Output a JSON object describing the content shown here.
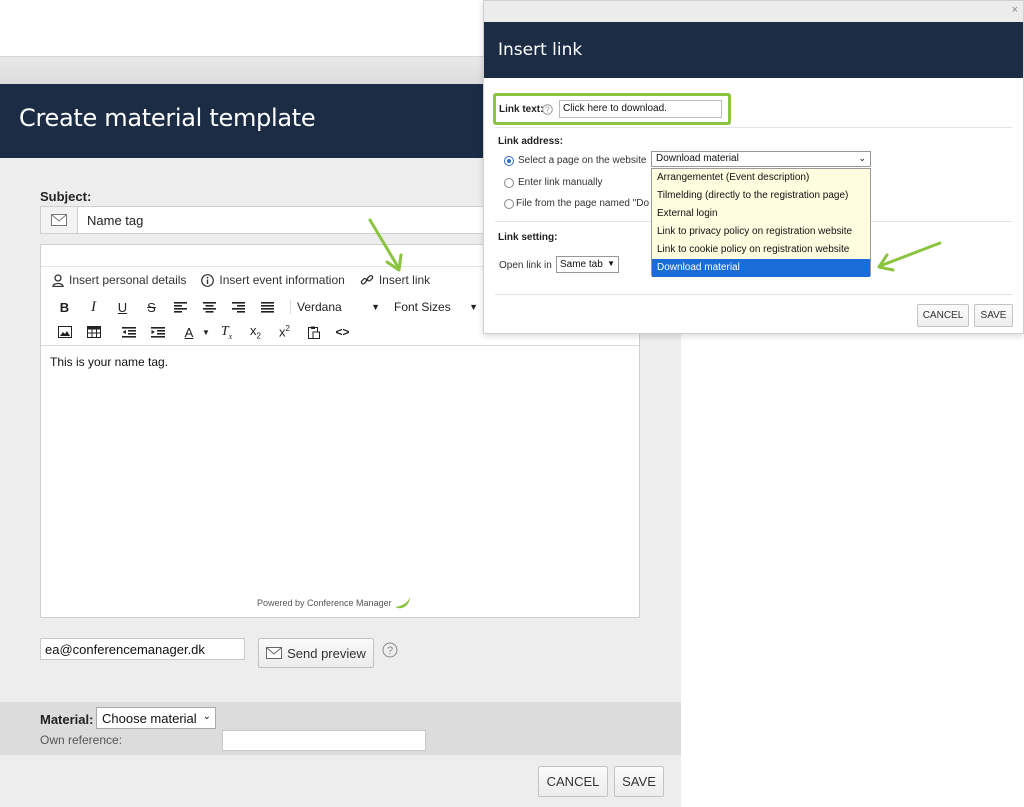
{
  "main": {
    "title": "Create material template",
    "subject_label": "Subject:",
    "subject_value": "Name tag",
    "insert_items": [
      "Insert personal details",
      "Insert event information",
      "Insert link"
    ],
    "font_name": "Verdana",
    "font_sizes": "Font Sizes",
    "body_text": "This is your name tag.",
    "powered_by": "Powered by Conference Manager",
    "preview_email": "ea@conferencemanager.dk",
    "send_preview": "Send preview",
    "material_label": "Material:",
    "material_value": "Choose material",
    "own_reference_label": "Own reference:",
    "own_reference_value": "",
    "cancel": "CANCEL",
    "save": "SAVE"
  },
  "dialog": {
    "close": "×",
    "title": "Insert link",
    "link_text_label": "Link text:",
    "link_text_value": "Click here to download.",
    "link_address_label": "Link address:",
    "option_page": "Select a page on the website",
    "option_manual": "Enter link manually",
    "option_file": "File from the page named \"Do",
    "selected_page": "Download material",
    "page_options": [
      "Arrangementet (Event description)",
      "Tilmelding (directly to the registration page)",
      "External login",
      "Link to privacy policy on registration website",
      "Link to cookie policy on registration website",
      "Download material"
    ],
    "link_setting_label": "Link setting:",
    "open_link_in_label": "Open link in",
    "open_link_in_value": "Same tab",
    "cancel": "CANCEL",
    "save": "SAVE"
  },
  "colors": {
    "header_bg": "#1b2c44",
    "highlight": "#8bc53f",
    "selected_option": "#1a6dd8"
  }
}
